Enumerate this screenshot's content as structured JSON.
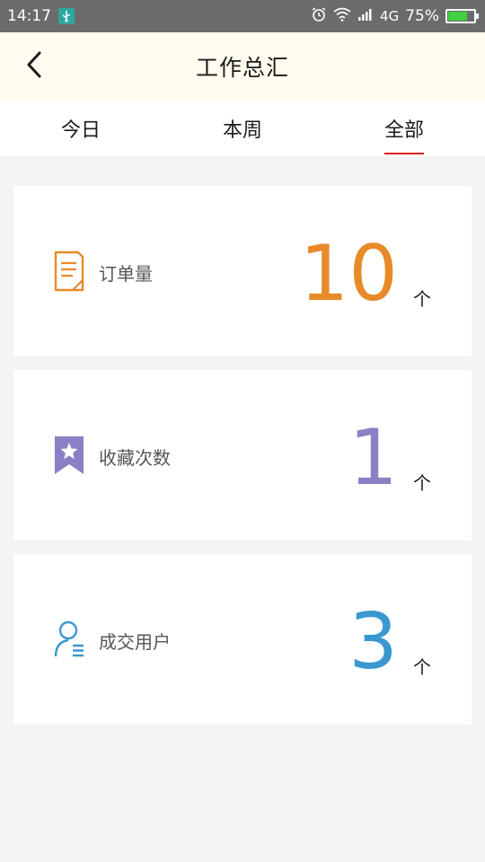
{
  "status_bar": {
    "time": "14:17",
    "network": "4G",
    "battery": "75%",
    "battery_level": 0.75
  },
  "header": {
    "title": "工作总汇",
    "back_icon": "chevron-left-icon"
  },
  "tabs": [
    {
      "label": "今日",
      "active": false
    },
    {
      "label": "本周",
      "active": false
    },
    {
      "label": "全部",
      "active": true
    }
  ],
  "cards": [
    {
      "label": "订单量",
      "value": "10",
      "unit": "个",
      "icon": "document-icon",
      "color": "#e88a2a"
    },
    {
      "label": "收藏次数",
      "value": "1",
      "unit": "个",
      "icon": "bookmark-star-icon",
      "color": "#8a80c4"
    },
    {
      "label": "成交用户",
      "value": "3",
      "unit": "个",
      "icon": "user-list-icon",
      "color": "#3a98d0"
    }
  ],
  "colors": {
    "header_bg": "#fffbee",
    "tab_indicator": "#e02020",
    "status_bar": "#6b6b6b"
  }
}
